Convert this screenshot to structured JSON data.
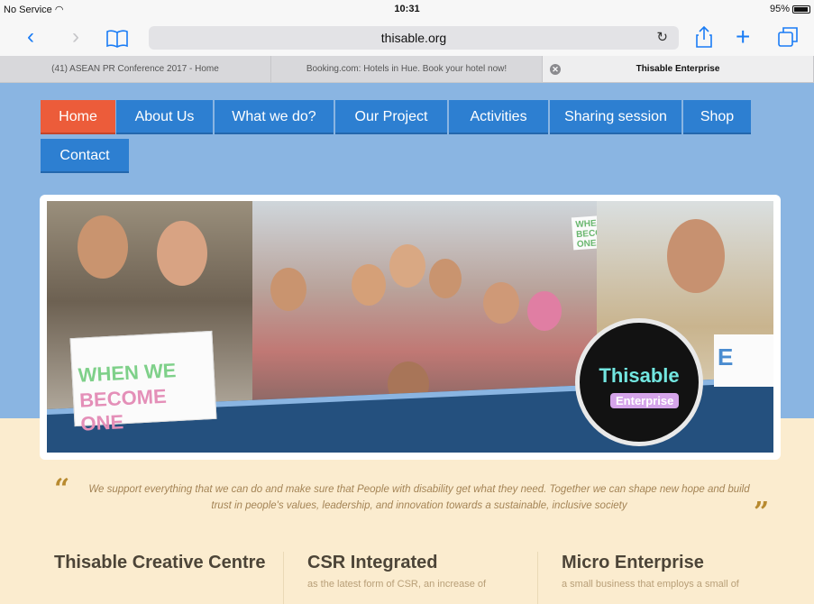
{
  "status_bar": {
    "carrier": "No Service",
    "time": "10:31",
    "battery": "95%"
  },
  "toolbar": {
    "url": "thisable.org",
    "icons": [
      "back-icon",
      "forward-icon",
      "bookmarks-icon",
      "reload-icon",
      "share-icon",
      "new-tab-icon",
      "tabs-icon"
    ]
  },
  "tabs": [
    {
      "title": "(41) ASEAN PR Conference 2017 - Home",
      "active": false
    },
    {
      "title": "Booking.com: Hotels in Hue. Book your hotel now!",
      "active": false
    },
    {
      "title": "Thisable Enterprise",
      "active": true
    }
  ],
  "nav": {
    "items": [
      "Home",
      "About Us",
      "What we do?",
      "Our Project",
      "Activities",
      "Sharing session",
      "Shop",
      "Contact"
    ],
    "active": "Home"
  },
  "banner": {
    "sign_line1": "WHEN WE",
    "sign_line2": "BECOME ONE",
    "logo_text": "Thisable",
    "logo_sub": "Enterprise"
  },
  "quote": {
    "text": "We support everything that we can do and make sure that People with disability get what they need. Together we can shape new hope and build trust in people's values, leadership, and innovation towards a sustainable, inclusive society",
    "open_mark": "“",
    "close_mark": "”"
  },
  "columns": [
    {
      "title": "Thisable Creative Centre",
      "text": ""
    },
    {
      "title": "CSR Integrated",
      "text": "as the latest form of CSR, an increase of"
    },
    {
      "title": "Micro Enterprise",
      "text": "a small business that employs a small of"
    }
  ],
  "colors": {
    "nav_blue": "#2d7fd1",
    "nav_active": "#ec5c3a",
    "page_blue": "#8ab5e2",
    "cream": "#fbeccf",
    "safari_blue": "#1a7cf5"
  }
}
